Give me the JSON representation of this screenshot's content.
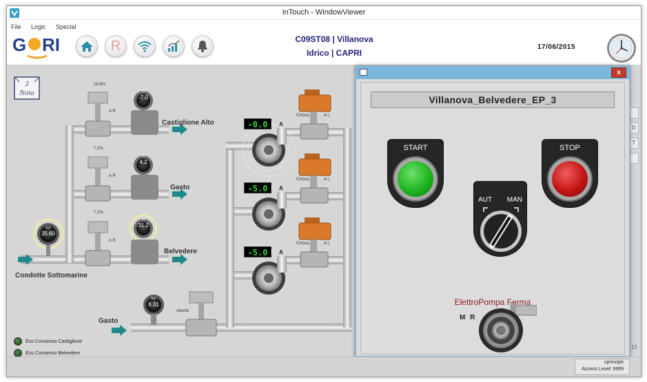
{
  "window": {
    "title": "InTouch - WindowViewer"
  },
  "menu": {
    "items": [
      "File",
      "Logic",
      "Special"
    ]
  },
  "header": {
    "logo_text": "GORI",
    "station": "C09ST08 | Villanova",
    "site": "Idrico | CAPRI",
    "date": "17/06/2015",
    "nav_icons": [
      "home-icon",
      "r-icon",
      "wifi-icon",
      "chart-icon",
      "bell-icon"
    ],
    "nav_r_label": "R"
  },
  "synoptic": {
    "nota_label": "Nota",
    "lines": [
      {
        "name": "Castiglione Alto",
        "valve_pct": "16.8%",
        "meter_value": "-7.0",
        "meter_unit": "l/s"
      },
      {
        "name": "Gasto",
        "valve_pct": "7.2%",
        "meter_value": "4.2",
        "meter_unit": "l/s"
      },
      {
        "name": "Belvedere",
        "valve_pct": "7.1%",
        "meter_value": "31.2",
        "meter_unit": "l/s"
      }
    ],
    "inlet_label": "Condotte Sottomarine",
    "inlet_pressure": "35.60",
    "inlet_pressure_unit": "bar",
    "gasto_inlet_label": "Gasto",
    "gasto_pressure": "6.31",
    "gasto_pressure_unit": "bar",
    "gasto_valve_label": "Aperta",
    "pumps": [
      {
        "current": "-0.0",
        "unit": "A",
        "valve_state": "Chiusa",
        "mode": "A L"
      },
      {
        "current": "-5.0",
        "unit": "A",
        "valve_state": "Chiusa",
        "mode": "A L"
      },
      {
        "current": "-5.0",
        "unit": "A",
        "valve_state": "Chiusa",
        "mode": "A L"
      }
    ],
    "ar_label": "A R",
    "eco_items": [
      "Eco Consenso Castiglione",
      "Eco Consenso Belvedere"
    ],
    "page_num": "15",
    "edge_buttons": [
      "",
      "D",
      "T",
      ""
    ]
  },
  "popup": {
    "title": "Villanova_Belvedere_EP_3",
    "start_label": "START",
    "stop_label": "STOP",
    "selector_aut": "AUT",
    "selector_man": "MAN",
    "status": "ElettroPompa Ferma",
    "mode_label": "M R",
    "close": "x",
    "colors": {
      "start": "#1fb51f",
      "stop": "#c41414",
      "title_bar": "#7bb6dc"
    }
  },
  "status": {
    "user": "cprincipe",
    "access_level": "Access Level:  9999"
  }
}
